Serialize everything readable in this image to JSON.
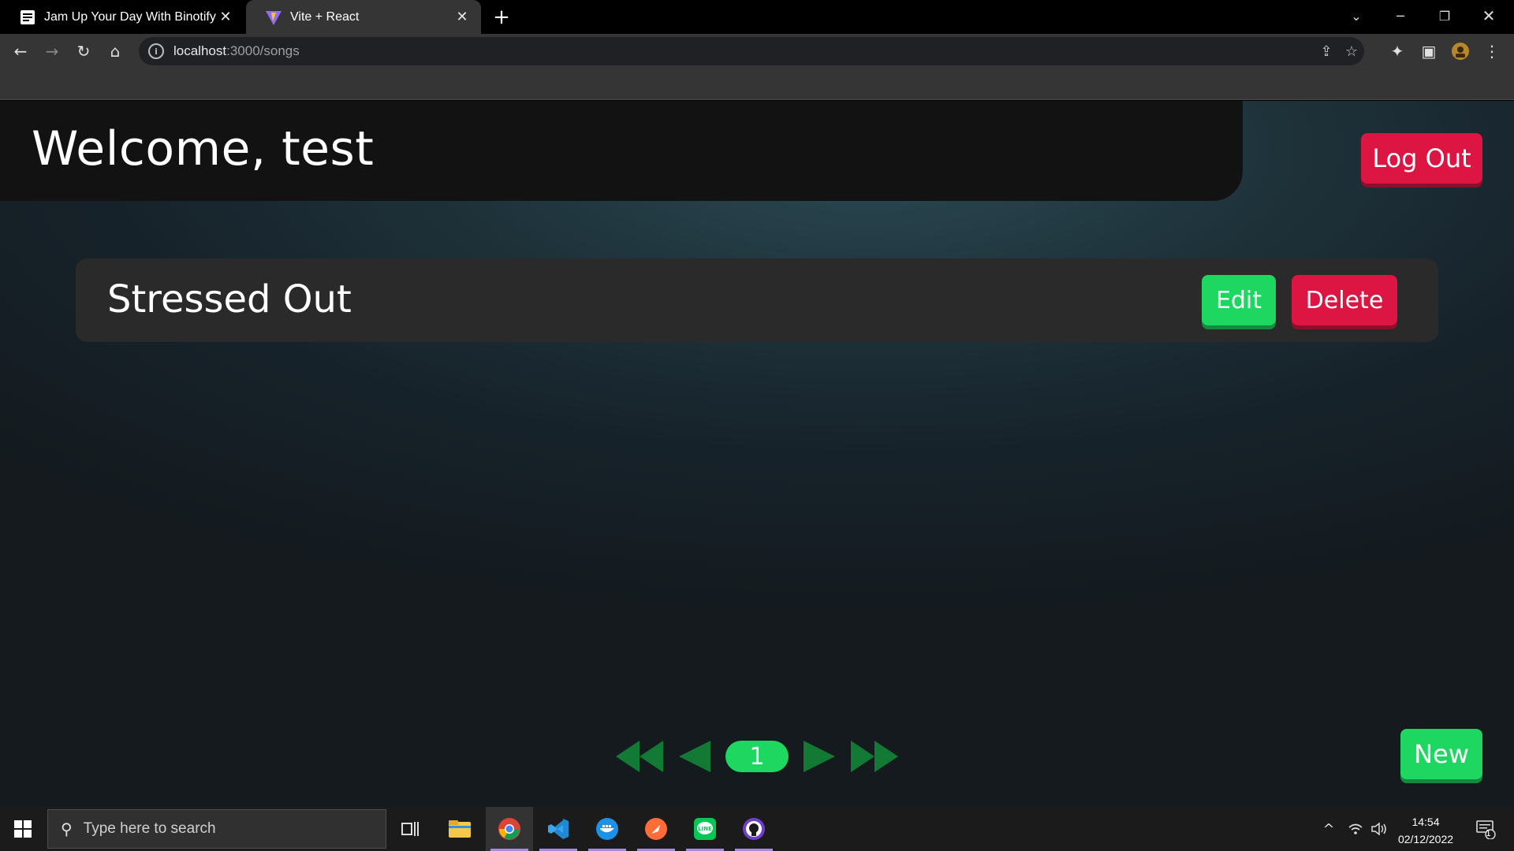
{
  "browser": {
    "tabs": [
      {
        "title": "Jam Up Your Day With Binotify",
        "icon": "binotify-favicon",
        "active": false
      },
      {
        "title": "Vite + React",
        "icon": "vite-favicon",
        "active": true
      }
    ],
    "url_host": "localhost",
    "url_path": ":3000/songs"
  },
  "page": {
    "welcome": "Welcome, test",
    "logout_label": "Log Out",
    "songs": [
      {
        "title": "Stressed Out",
        "edit_label": "Edit",
        "delete_label": "Delete"
      }
    ],
    "pagination": {
      "current_page": "1"
    },
    "new_label": "New"
  },
  "colors": {
    "accent_green": "#1ed760",
    "accent_red": "#dc1543",
    "pager_arrow": "#137a35"
  },
  "taskbar": {
    "search_placeholder": "Type here to search",
    "time": "14:54",
    "date": "02/12/2022",
    "notification_count": "1",
    "apps": [
      "task-view-icon",
      "file-explorer-icon",
      "chrome-icon",
      "vscode-icon",
      "docker-icon",
      "postman-icon",
      "line-icon",
      "github-desktop-icon"
    ]
  }
}
